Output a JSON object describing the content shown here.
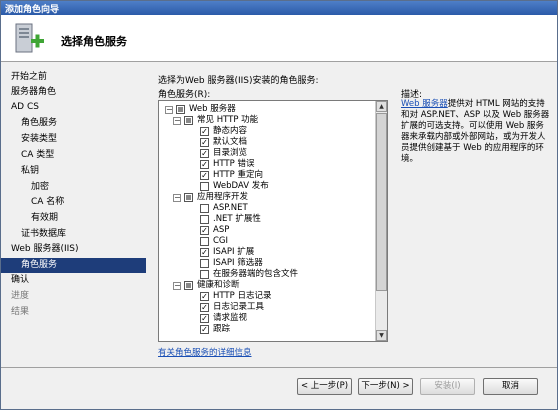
{
  "window": {
    "title": "添加角色向导"
  },
  "header": {
    "title": "选择角色服务",
    "icon": "server-add-icon"
  },
  "sidebar": {
    "items": [
      {
        "label": "开始之前",
        "state": "normal"
      },
      {
        "label": "服务器角色",
        "state": "normal"
      },
      {
        "label": "AD CS",
        "state": "normal"
      },
      {
        "label": "角色服务",
        "state": "normal"
      },
      {
        "label": "安装类型",
        "state": "normal"
      },
      {
        "label": "CA 类型",
        "state": "normal"
      },
      {
        "label": "私钥",
        "state": "normal"
      },
      {
        "label": "加密",
        "state": "normal"
      },
      {
        "label": "CA 名称",
        "state": "normal"
      },
      {
        "label": "有效期",
        "state": "normal"
      },
      {
        "label": "证书数据库",
        "state": "normal"
      },
      {
        "label": "Web 服务器(IIS)",
        "state": "normal"
      },
      {
        "label": "角色服务",
        "state": "selected"
      },
      {
        "label": "确认",
        "state": "normal"
      },
      {
        "label": "进度",
        "state": "disabled"
      },
      {
        "label": "结果",
        "state": "disabled"
      }
    ]
  },
  "main": {
    "instruction": "选择为Web 服务器(IIS)安装的角色服务:",
    "tree_label": "角色服务(R):",
    "tree": [
      {
        "label": "Web 服务器",
        "level": 0,
        "expander": "−",
        "check": "partial"
      },
      {
        "label": "常见 HTTP 功能",
        "level": 1,
        "expander": "−",
        "check": "partial"
      },
      {
        "label": "静态内容",
        "level": 2,
        "expander": "",
        "check": "checked"
      },
      {
        "label": "默认文档",
        "level": 2,
        "expander": "",
        "check": "checked"
      },
      {
        "label": "目录浏览",
        "level": 2,
        "expander": "",
        "check": "checked"
      },
      {
        "label": "HTTP 错误",
        "level": 2,
        "expander": "",
        "check": "checked"
      },
      {
        "label": "HTTP 重定向",
        "level": 2,
        "expander": "",
        "check": "checked"
      },
      {
        "label": "WebDAV 发布",
        "level": 2,
        "expander": "",
        "check": "unchecked"
      },
      {
        "label": "应用程序开发",
        "level": 1,
        "expander": "−",
        "check": "partial"
      },
      {
        "label": "ASP.NET",
        "level": 2,
        "expander": "",
        "check": "unchecked"
      },
      {
        "label": ".NET 扩展性",
        "level": 2,
        "expander": "",
        "check": "unchecked"
      },
      {
        "label": "ASP",
        "level": 2,
        "expander": "",
        "check": "checked"
      },
      {
        "label": "CGI",
        "level": 2,
        "expander": "",
        "check": "unchecked"
      },
      {
        "label": "ISAPI 扩展",
        "level": 2,
        "expander": "",
        "check": "checked"
      },
      {
        "label": "ISAPI 筛选器",
        "level": 2,
        "expander": "",
        "check": "unchecked"
      },
      {
        "label": "在服务器端的包含文件",
        "level": 2,
        "expander": "",
        "check": "unchecked"
      },
      {
        "label": "健康和诊断",
        "level": 1,
        "expander": "−",
        "check": "partial"
      },
      {
        "label": "HTTP 日志记录",
        "level": 2,
        "expander": "",
        "check": "checked"
      },
      {
        "label": "日志记录工具",
        "level": 2,
        "expander": "",
        "check": "checked"
      },
      {
        "label": "请求监视",
        "level": 2,
        "expander": "",
        "check": "checked"
      },
      {
        "label": "跟踪",
        "level": 2,
        "expander": "",
        "check": "checked"
      }
    ],
    "more_info_link": "有关角色服务的详细信息",
    "description": {
      "title": "描述:",
      "link_text": "Web 服务器",
      "body": "提供对 HTML 网站的支持和对 ASP.NET、ASP 以及 Web 服务器扩展的可选支持。可以使用 Web 服务器来承载内部或外部网站，或为开发人员提供创建基于 Web 的应用程序的环境。"
    }
  },
  "footer": {
    "prev_button": "< 上一步(P)",
    "next_button": "下一步(N) >",
    "install_button": "安装(I)",
    "cancel_button": "取消"
  },
  "colors": {
    "selected_bg": "#1e3d7a",
    "link": "#1a4fb5",
    "titlebar": "#2b5aa8"
  }
}
